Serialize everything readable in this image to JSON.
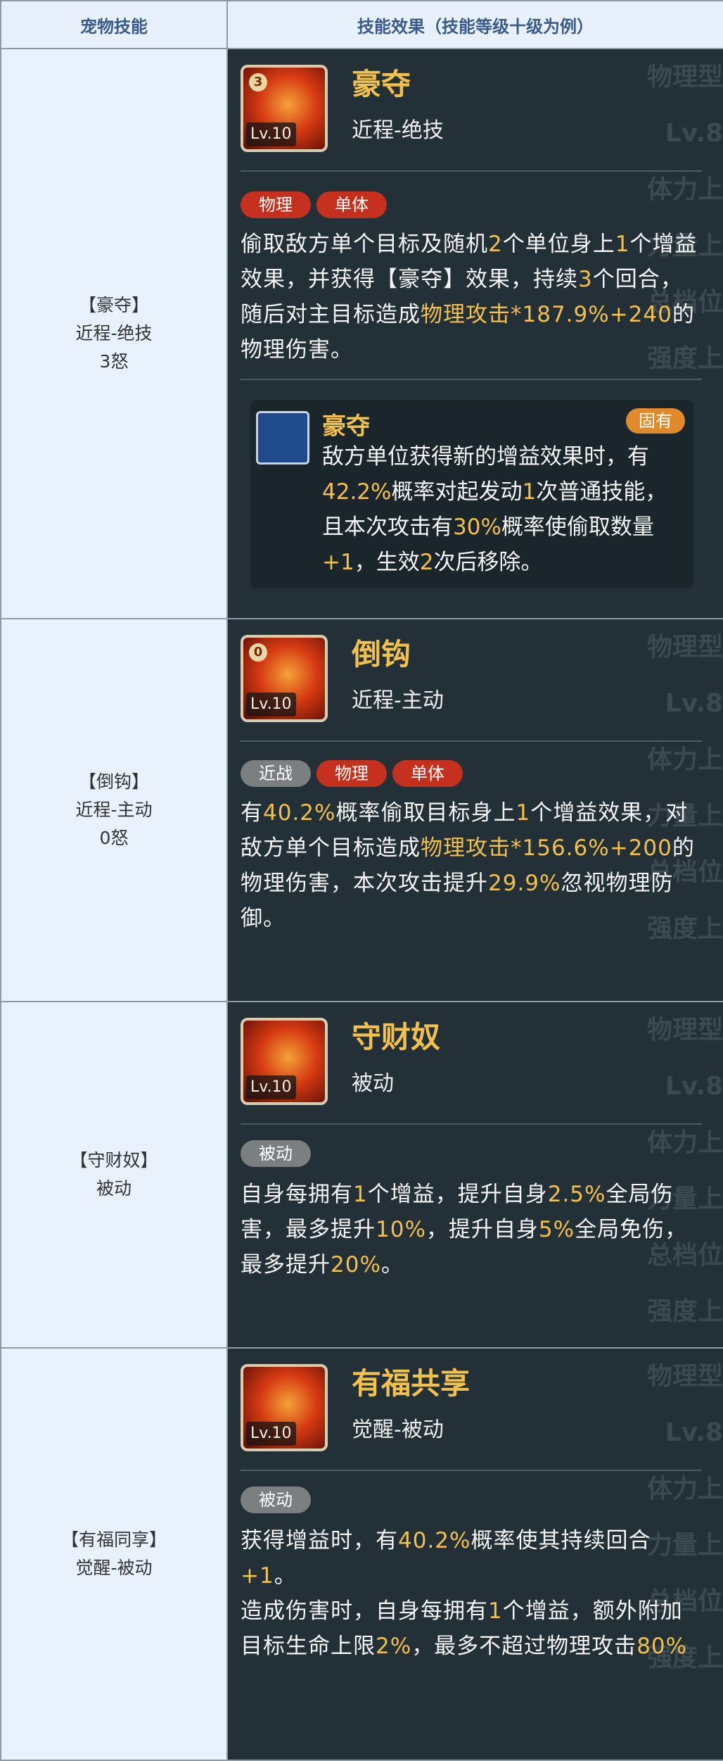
{
  "header": {
    "col1": "宠物技能",
    "col2": "技能效果（技能等级十级为例）"
  },
  "deco_text": [
    "物理型",
    "Lv.8",
    "体力上",
    "力量上",
    "总档位",
    "强度上"
  ],
  "rows": [
    {
      "left": {
        "name": "【豪夺】",
        "type": "近程-绝技",
        "cost": "3怒"
      },
      "skill": {
        "title": "豪夺",
        "type": "近程-绝技",
        "level": "Lv.10",
        "count": "3",
        "tags": [
          "物理",
          "单体"
        ],
        "desc": [
          {
            "t": "偷取敌方单个目标及随机"
          },
          {
            "t": "2",
            "h": 1
          },
          {
            "t": "个单位身上"
          },
          {
            "t": "1",
            "h": 1
          },
          {
            "t": "个增益效果，并获得【豪夺】效果，持续"
          },
          {
            "t": "3",
            "h": 1
          },
          {
            "t": "个回合，随后对主目标造成"
          },
          {
            "t": "物理攻击",
            "h": 1
          },
          {
            "t": "*187.9%+240",
            "h": 1
          },
          {
            "t": "的物理伤害。"
          }
        ],
        "passive": {
          "name": "豪夺",
          "badge": "固有",
          "desc": [
            {
              "t": "敌方单位获得新的增益效果时，有"
            },
            {
              "t": "42.2%",
              "h": 1
            },
            {
              "t": "概率对起发动"
            },
            {
              "t": "1",
              "h": 1
            },
            {
              "t": "次普通技能，且本次攻击有"
            },
            {
              "t": "30%",
              "h": 1
            },
            {
              "t": "概率使偷取数量"
            },
            {
              "t": "+1",
              "h": 1
            },
            {
              "t": "，生效"
            },
            {
              "t": "2",
              "h": 1
            },
            {
              "t": "次后移除。"
            }
          ]
        }
      }
    },
    {
      "left": {
        "name": "【倒钩】",
        "type": "近程-主动",
        "cost": "0怒"
      },
      "skill": {
        "title": "倒钩",
        "type": "近程-主动",
        "level": "Lv.10",
        "count": "0",
        "tags": [
          "近战",
          "物理",
          "单体"
        ],
        "desc": [
          {
            "t": "有"
          },
          {
            "t": "40.2%",
            "h": 1
          },
          {
            "t": "概率偷取目标身上"
          },
          {
            "t": "1",
            "h": 1
          },
          {
            "t": "个增益效果，对敌方单个目标造成"
          },
          {
            "t": "物理攻击",
            "h": 1
          },
          {
            "t": "*156.6%+200",
            "h": 1
          },
          {
            "t": "的物理伤害，本次攻击提升"
          },
          {
            "t": "29.9%",
            "h": 1
          },
          {
            "t": "忽视物理防御。"
          }
        ]
      }
    },
    {
      "left": {
        "name": "【守财奴】",
        "type": "被动",
        "cost": ""
      },
      "skill": {
        "title": "守财奴",
        "type": "被动",
        "level": "Lv.10",
        "tags": [
          "被动"
        ],
        "desc": [
          {
            "t": "自身每拥有"
          },
          {
            "t": "1",
            "h": 1
          },
          {
            "t": "个增益，提升自身"
          },
          {
            "t": "2.5%",
            "h": 1
          },
          {
            "t": "全局伤害，最多提升"
          },
          {
            "t": "10%",
            "h": 1
          },
          {
            "t": "，提升自身"
          },
          {
            "t": "5%",
            "h": 1
          },
          {
            "t": "全局免伤，最多提升"
          },
          {
            "t": "20%",
            "h": 1
          },
          {
            "t": "。"
          }
        ]
      }
    },
    {
      "left": {
        "name": "【有福同享】",
        "type": "觉醒-被动",
        "cost": ""
      },
      "skill": {
        "title": "有福共享",
        "type": "觉醒-被动",
        "level": "Lv.10",
        "tags": [
          "被动"
        ],
        "desc": [
          {
            "t": "获得增益时，有"
          },
          {
            "t": "40.2%",
            "h": 1
          },
          {
            "t": "概率使其持续回合"
          },
          {
            "t": "+1",
            "h": 1
          },
          {
            "t": "。"
          },
          {
            "br": 1
          },
          {
            "t": "造成伤害时，自身每拥有"
          },
          {
            "t": "1",
            "h": 1
          },
          {
            "t": "个增益，额外附加目标生命上限"
          },
          {
            "t": "2%",
            "h": 1
          },
          {
            "t": "，最多不超过物理攻击"
          },
          {
            "t": "80%",
            "h": 1
          }
        ]
      }
    }
  ],
  "colors": {
    "highlight": "#f2c04c",
    "tag_red": "#c6301e",
    "tag_gray": "#7c7f82",
    "panel": "#233037"
  }
}
